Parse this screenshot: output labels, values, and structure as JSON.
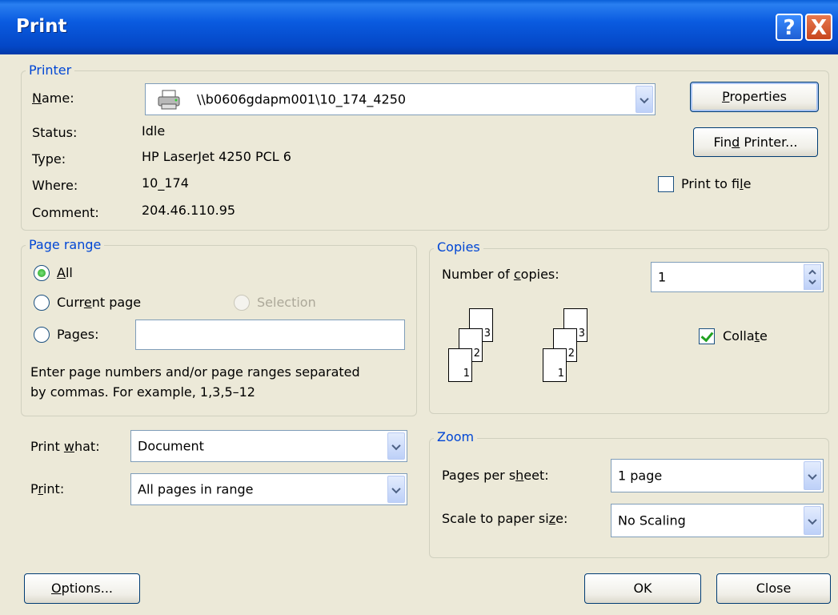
{
  "window": {
    "title": "Print",
    "help_glyph": "?",
    "close_glyph": "X"
  },
  "printer": {
    "legend": "Printer",
    "name_label": "Name:",
    "name_value": "\\\\b0606gdapm001\\10_174_4250",
    "status_label": "Status:",
    "status_value": "Idle",
    "type_label": "Type:",
    "type_value": "HP LaserJet 4250 PCL 6",
    "where_label": "Where:",
    "where_value": "10_174",
    "comment_label": "Comment:",
    "comment_value": "204.46.110.95",
    "properties_button": "Properties",
    "find_printer_button": "Find Printer...",
    "print_to_file_label": "Print to file",
    "print_to_file_checked": false
  },
  "page_range": {
    "legend": "Page range",
    "all_label": "All",
    "current_page_label": "Current page",
    "selection_label": "Selection",
    "pages_label": "Pages:",
    "pages_value": "",
    "selected": "all",
    "help_text_line1": "Enter page numbers and/or page ranges separated",
    "help_text_line2": "by commas.  For example, 1,3,5–12"
  },
  "copies": {
    "legend": "Copies",
    "number_label": "Number of copies:",
    "number_value": "1",
    "collate_label": "Collate",
    "collate_checked": true,
    "page_numbers": [
      "1",
      "2",
      "3"
    ]
  },
  "print_what": {
    "label": "Print what:",
    "value": "Document"
  },
  "print": {
    "label": "Print:",
    "value": "All pages in range"
  },
  "zoom": {
    "legend": "Zoom",
    "pages_per_sheet_label": "Pages per sheet:",
    "pages_per_sheet_value": "1 page",
    "scale_label": "Scale to paper size:",
    "scale_value": "No Scaling"
  },
  "buttons": {
    "options": "Options...",
    "ok": "OK",
    "close": "Close"
  },
  "colors": {
    "title_bar": "#0a5be0",
    "dialog_bg": "#ece9d8",
    "legend_text": "#0046d5"
  }
}
